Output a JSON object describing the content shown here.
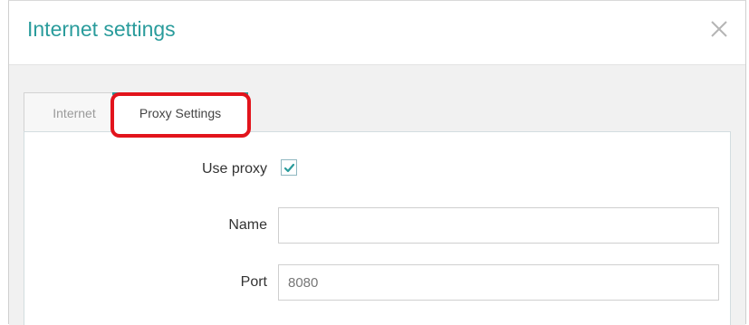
{
  "dialog": {
    "title": "Internet settings",
    "close_icon": "close-icon"
  },
  "tabs": [
    {
      "label": "Internet",
      "active": false
    },
    {
      "label": "Proxy Settings",
      "active": true
    }
  ],
  "form": {
    "use_proxy_label": "Use proxy",
    "use_proxy_checked": true,
    "name_label": "Name",
    "name_value": "",
    "port_label": "Port",
    "port_value": "8080"
  },
  "colors": {
    "accent": "#2a9c9c",
    "highlight": "#e2141c"
  }
}
